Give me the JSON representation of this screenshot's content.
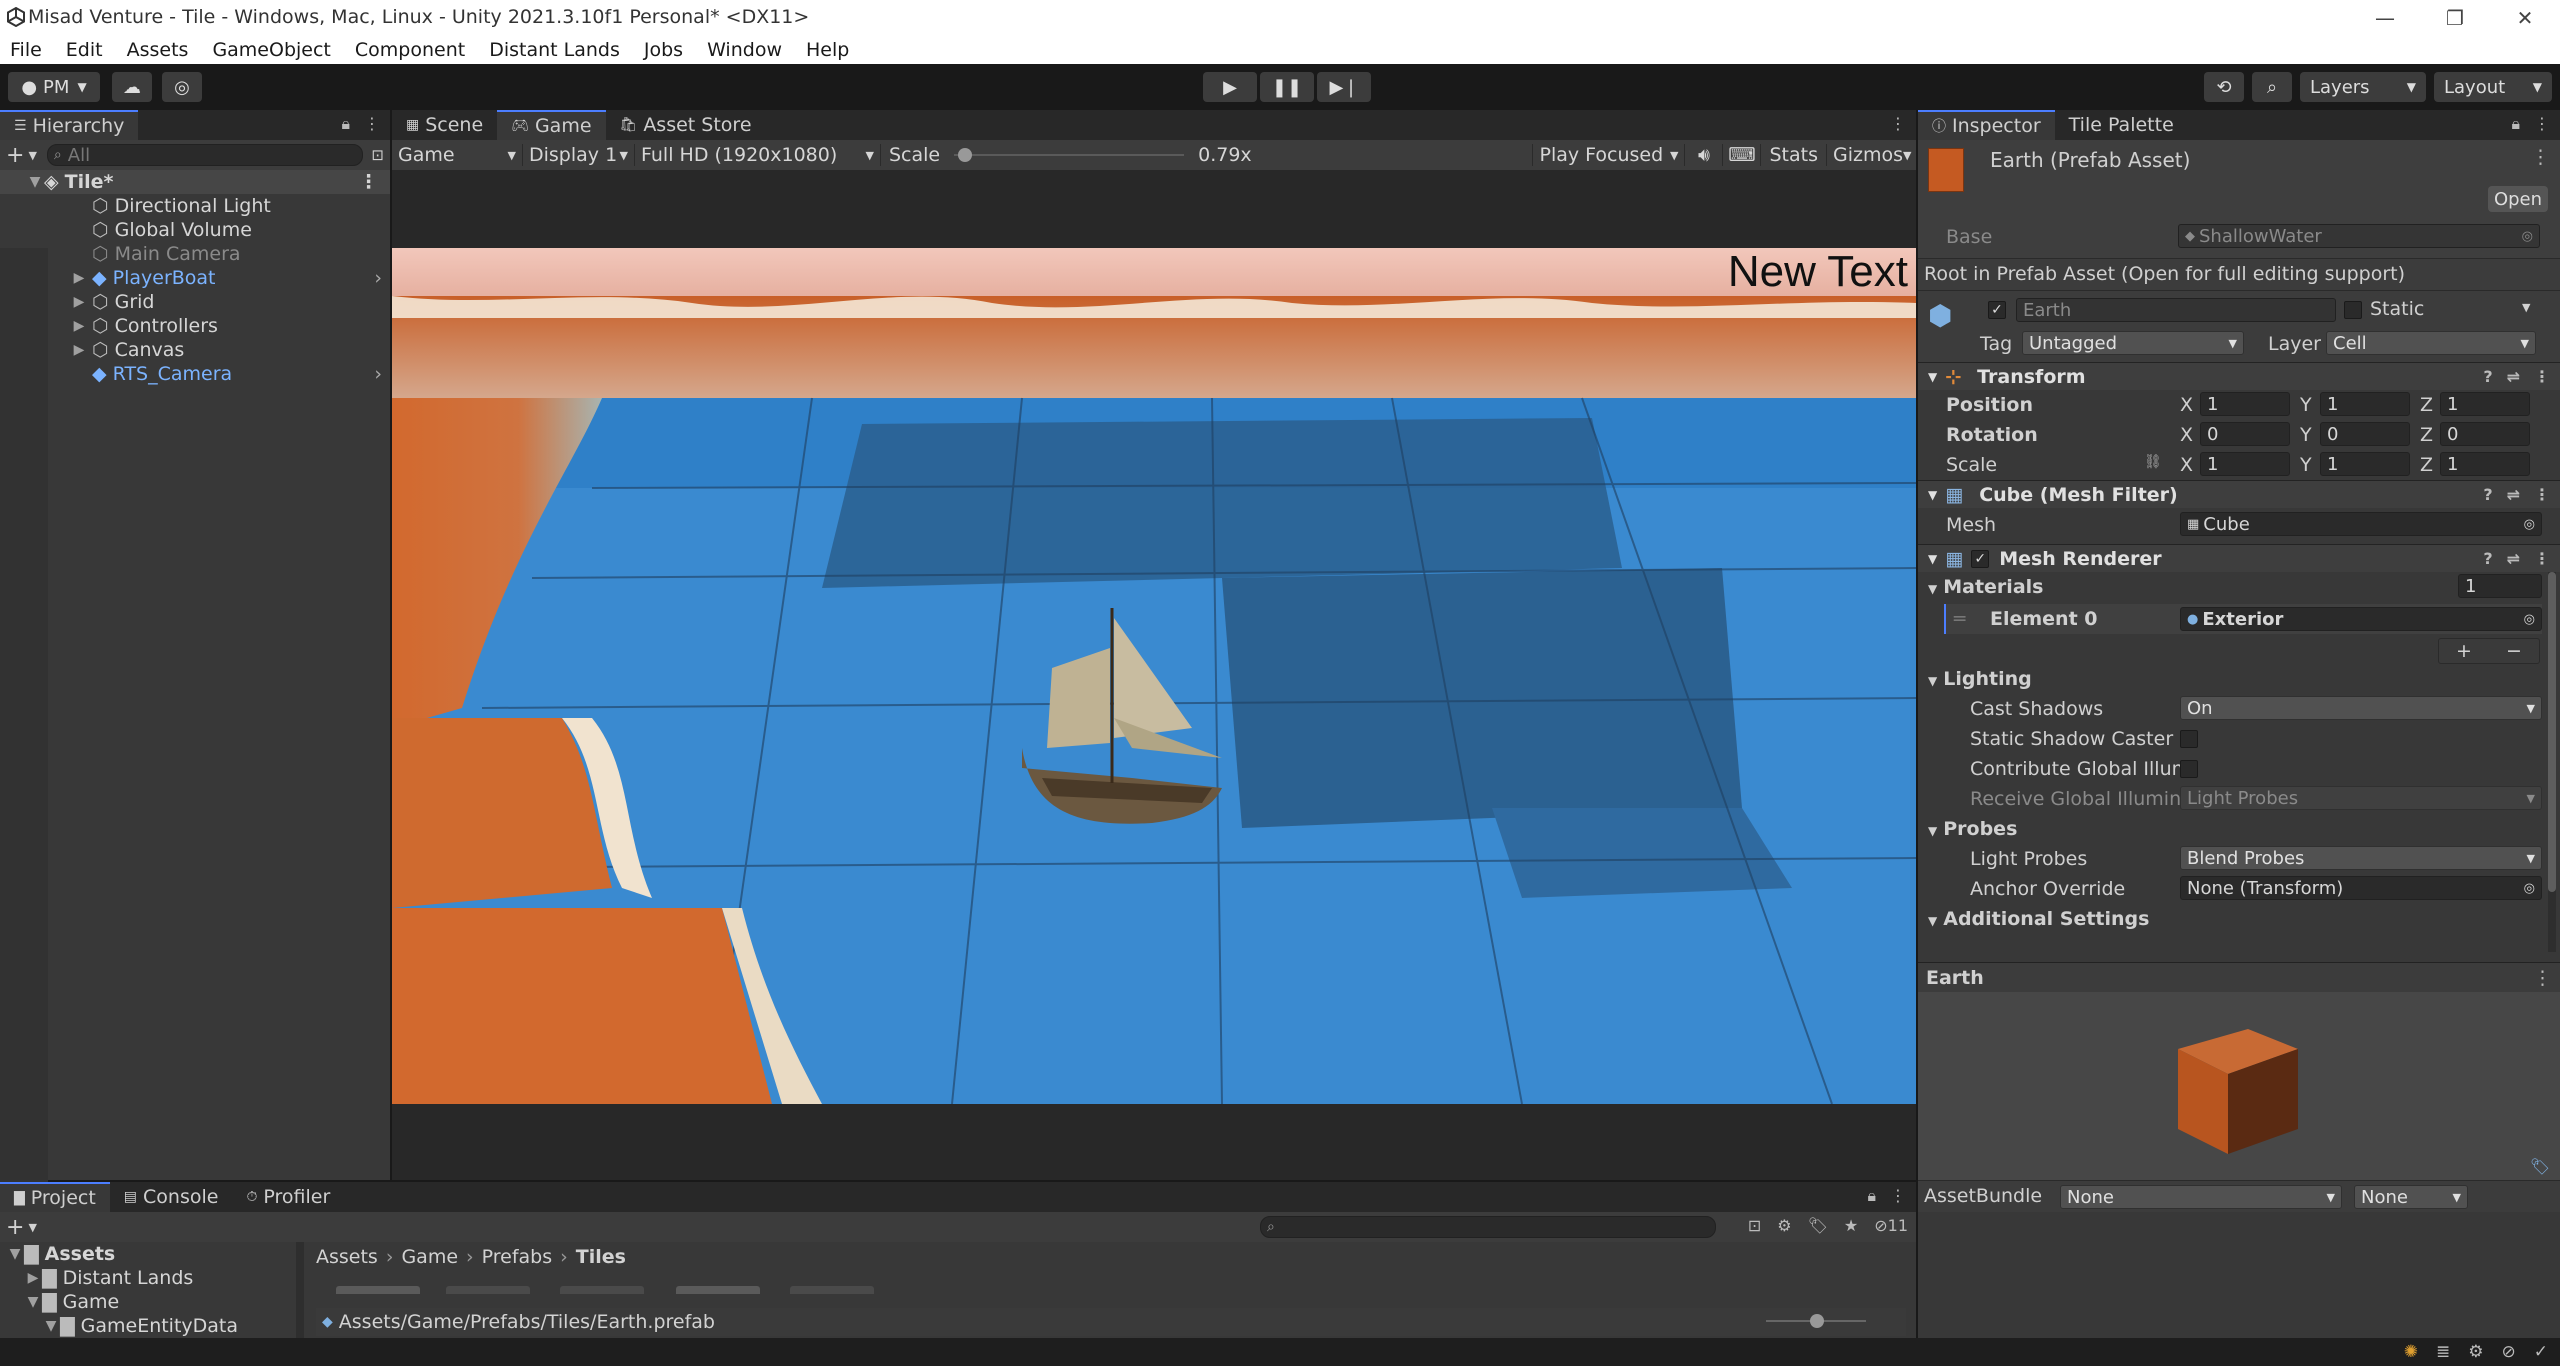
{
  "window": {
    "title": "Misad Venture - Tile - Windows, Mac, Linux - Unity 2021.3.10f1 Personal* <DX11>",
    "controls": {
      "minimize": "—",
      "maximize": "❐",
      "close": "✕"
    }
  },
  "menu": [
    "File",
    "Edit",
    "Assets",
    "GameObject",
    "Component",
    "Distant Lands",
    "Jobs",
    "Window",
    "Help"
  ],
  "toolbar": {
    "account": "PM",
    "layers": "Layers",
    "layout": "Layout"
  },
  "hierarchy": {
    "tab": "Hierarchy",
    "search_placeholder": "All",
    "scene": "Tile*",
    "items": [
      {
        "label": "Directional Light"
      },
      {
        "label": "Global Volume"
      },
      {
        "label": "Main Camera"
      },
      {
        "label": "PlayerBoat"
      },
      {
        "label": "Grid"
      },
      {
        "label": "Controllers"
      },
      {
        "label": "Canvas"
      },
      {
        "label": "RTS_Camera"
      }
    ]
  },
  "game_view": {
    "tabs": [
      "Scene",
      "Game",
      "Asset Store"
    ],
    "mode": "Game",
    "display": "Display 1",
    "resolution": "Full HD (1920x1080)",
    "scale_label": "Scale",
    "scale_value": "0.79x",
    "scale_fraction": 0.02,
    "play_mode": "Play Focused",
    "stats": "Stats",
    "gizmos": "Gizmos",
    "overlay_text": "New Text"
  },
  "inspector": {
    "tabs": [
      "Inspector",
      "Tile Palette"
    ],
    "asset_title": "Earth (Prefab Asset)",
    "open_button": "Open",
    "base_label": "Base",
    "base_value": "ShallowWater",
    "root_note": "Root in Prefab Asset (Open for full editing support)",
    "name": "Earth",
    "static": "Static",
    "tag_label": "Tag",
    "tag_value": "Untagged",
    "layer_label": "Layer",
    "layer_value": "Cell",
    "transform": {
      "title": "Transform",
      "position_label": "Position",
      "rotation_label": "Rotation",
      "scale_label": "Scale",
      "position": [
        "1",
        "1",
        "1"
      ],
      "rotation": [
        "0",
        "0",
        "0"
      ],
      "scale": [
        "1",
        "1",
        "1"
      ]
    },
    "mesh_filter": {
      "title": "Cube (Mesh Filter)",
      "mesh_label": "Mesh",
      "mesh_value": "Cube"
    },
    "mesh_renderer": {
      "title": "Mesh Renderer",
      "materials_label": "Materials",
      "materials_count": "1",
      "element_label": "Element 0",
      "element_value": "Exterior",
      "lighting_label": "Lighting",
      "cast_shadows_label": "Cast Shadows",
      "cast_shadows_value": "On",
      "static_caster_label": "Static Shadow Caster",
      "contribute_gi_label": "Contribute Global Illumi",
      "receive_gi_label": "Receive Global Illumina",
      "receive_gi_value": "Light Probes",
      "probes_label": "Probes",
      "light_probes_label": "Light Probes",
      "light_probes_value": "Blend Probes",
      "anchor_label": "Anchor Override",
      "anchor_value": "None (Transform)",
      "additional_label": "Additional Settings"
    },
    "preview_title": "Earth",
    "assetbundle_label": "AssetBundle",
    "assetbundle_value": "None",
    "assetbundle_variant": "None"
  },
  "project": {
    "tabs": [
      "Project",
      "Console",
      "Profiler"
    ],
    "tree": [
      {
        "label": "Assets"
      },
      {
        "label": "Distant Lands"
      },
      {
        "label": "Game"
      },
      {
        "label": "GameEntityData"
      }
    ],
    "breadcrumb": [
      "Assets",
      "Game",
      "Prefabs",
      "Tiles"
    ],
    "path": "Assets/Game/Prefabs/Tiles/Earth.prefab",
    "hidden_count": "11"
  },
  "colors": {
    "accent": "#4c7eff",
    "panel": "#383838",
    "water": "#3a8ad0",
    "land": "#d2692e"
  }
}
